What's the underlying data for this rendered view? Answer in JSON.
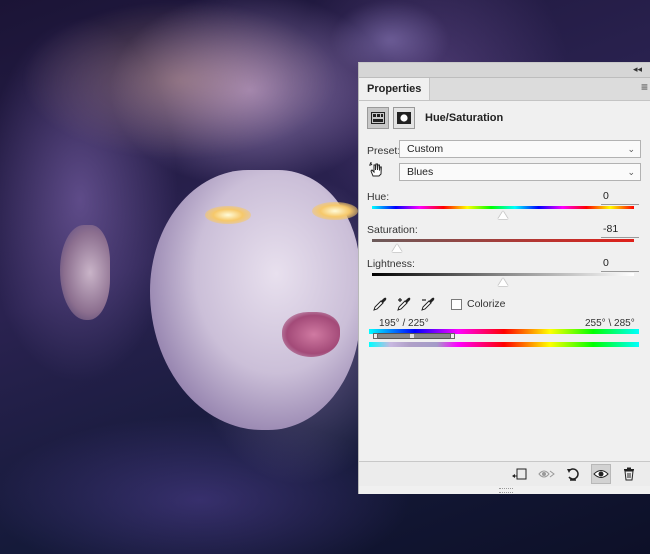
{
  "panel": {
    "tab_label": "Properties",
    "adjustment_title": "Hue/Saturation",
    "preset_label": "Preset:",
    "preset_value": "Custom",
    "channel_value": "Blues",
    "hue_label": "Hue:",
    "hue_value": "0",
    "saturation_label": "Saturation:",
    "saturation_value": "-81",
    "lightness_label": "Lightness:",
    "lightness_value": "0",
    "colorize_label": "Colorize",
    "colorize_checked": false,
    "range_left": "195° / 225°",
    "range_right": "255° \\ 285°"
  },
  "sliders": {
    "hue_level": 0.5,
    "saturation_level": 0.095,
    "lightness_level": 0.5
  },
  "icons": {
    "collapse": "double-chevron-icon",
    "menu": "panel-menu-icon",
    "adjustment_layer": "hue-saturation-layer-icon",
    "mask": "layer-mask-icon",
    "hand": "targeted-adjustment-hand-icon",
    "eyedropper": "eyedropper-icon",
    "eyedropper_add": "eyedropper-add-icon",
    "eyedropper_subtract": "eyedropper-subtract-icon",
    "clip": "clip-to-layer-icon",
    "view_previous": "view-previous-state-icon",
    "reset": "reset-icon",
    "visibility": "eye-icon",
    "delete": "trash-icon"
  },
  "colors": {
    "panel_bg": "#f0f0f0",
    "saturation_track_start": "#6b5b5b",
    "saturation_track_end": "#e0201a"
  }
}
